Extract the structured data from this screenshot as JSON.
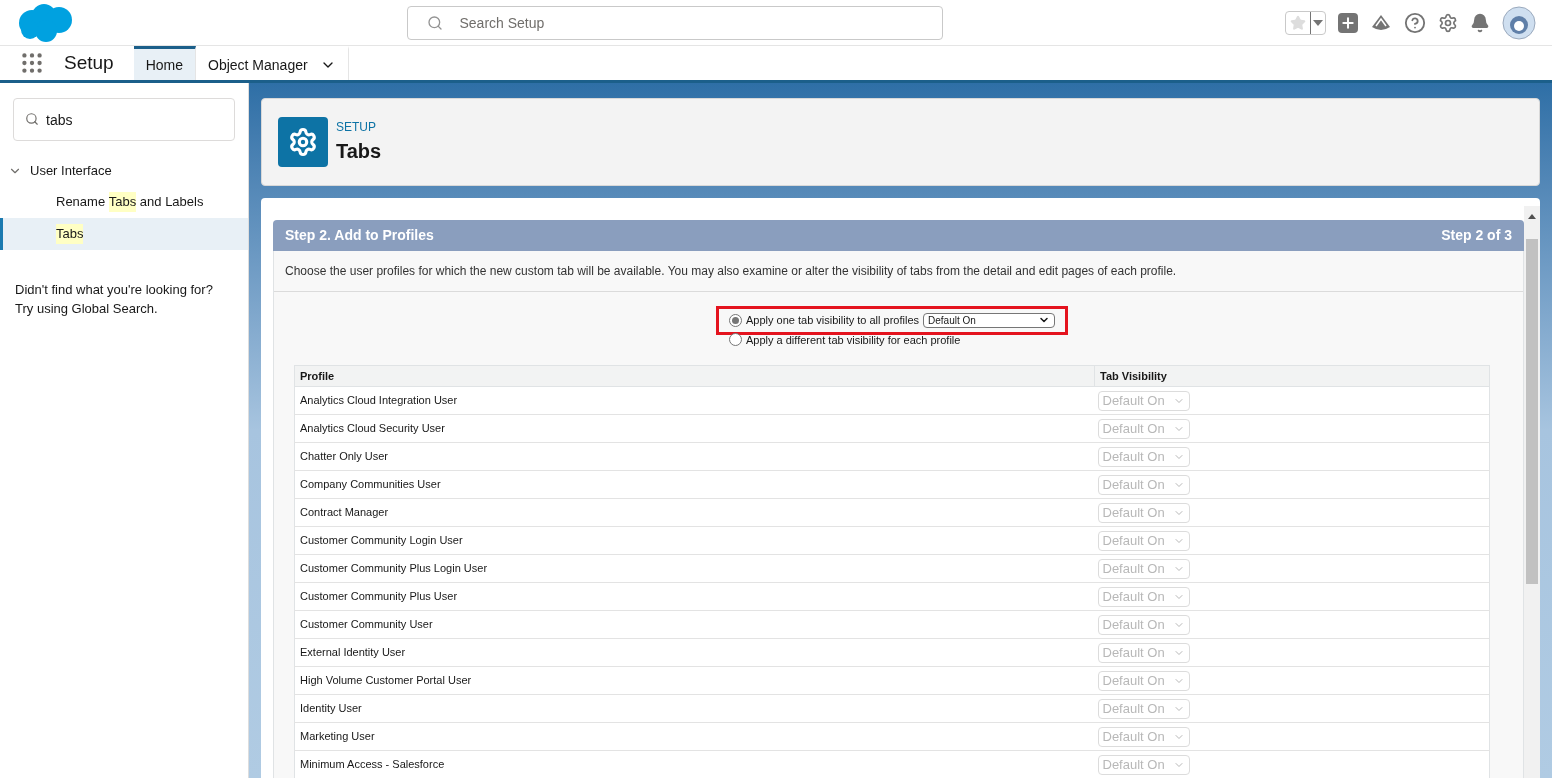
{
  "header": {
    "search_placeholder": "Search Setup"
  },
  "nav": {
    "app_name": "Setup",
    "tabs": [
      {
        "label": "Home",
        "selected": true,
        "has_menu": false
      },
      {
        "label": "Object Manager",
        "selected": false,
        "has_menu": true
      }
    ]
  },
  "sidebar": {
    "search_value": "tabs",
    "groups": [
      {
        "label": "User Interface",
        "expanded": true,
        "children": [
          {
            "selected": false,
            "parts": [
              {
                "text": "Rename ",
                "highlight": false
              },
              {
                "text": "Tabs",
                "highlight": true
              },
              {
                "text": " and Labels",
                "highlight": false
              }
            ]
          },
          {
            "selected": true,
            "parts": [
              {
                "text": "Tabs",
                "highlight": true
              }
            ]
          }
        ]
      }
    ],
    "help_lines": [
      "Didn't find what you're looking for?",
      "Try using Global Search."
    ]
  },
  "page_header": {
    "eyebrow": "SETUP",
    "title": "Tabs"
  },
  "wizard": {
    "title": "Step 2. Add to Profiles",
    "step": "Step 2 of 3",
    "description": "Choose the user profiles for which the new custom tab will be available. You may also examine or alter the visibility of tabs from the detail and edit pages of each profile.",
    "options": [
      {
        "label": "Apply one tab visibility to all profiles",
        "selected": true,
        "select_value": "Default On",
        "highlighted": true
      },
      {
        "label": "Apply a different tab visibility for each profile",
        "selected": false,
        "highlighted": false
      }
    ],
    "table": {
      "columns": [
        "Profile",
        "Tab Visibility"
      ],
      "rows": [
        {
          "profile": "Analytics Cloud Integration User",
          "visibility": "Default On",
          "disabled": true
        },
        {
          "profile": "Analytics Cloud Security User",
          "visibility": "Default On",
          "disabled": true
        },
        {
          "profile": "Chatter Only User",
          "visibility": "Default On",
          "disabled": true
        },
        {
          "profile": "Company Communities User",
          "visibility": "Default On",
          "disabled": true
        },
        {
          "profile": "Contract Manager",
          "visibility": "Default On",
          "disabled": true
        },
        {
          "profile": "Customer Community Login User",
          "visibility": "Default On",
          "disabled": true
        },
        {
          "profile": "Customer Community Plus Login User",
          "visibility": "Default On",
          "disabled": true
        },
        {
          "profile": "Customer Community Plus User",
          "visibility": "Default On",
          "disabled": true
        },
        {
          "profile": "Customer Community User",
          "visibility": "Default On",
          "disabled": true
        },
        {
          "profile": "External Identity User",
          "visibility": "Default On",
          "disabled": true
        },
        {
          "profile": "High Volume Customer Portal User",
          "visibility": "Default On",
          "disabled": true
        },
        {
          "profile": "Identity User",
          "visibility": "Default On",
          "disabled": true
        },
        {
          "profile": "Marketing User",
          "visibility": "Default On",
          "disabled": true
        },
        {
          "profile": "Minimum Access - Salesforce",
          "visibility": "Default On",
          "disabled": true
        }
      ]
    }
  }
}
